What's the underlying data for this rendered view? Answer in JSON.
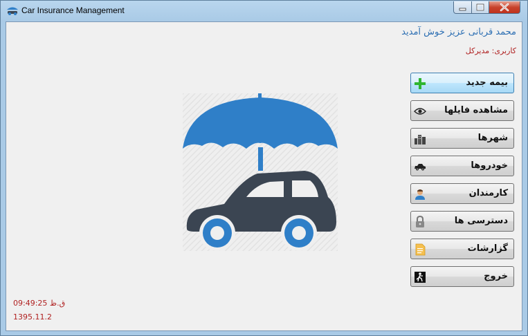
{
  "window": {
    "title": "Car Insurance Management"
  },
  "header": {
    "welcome": "محمد قربانی عزیز خوش آمدید",
    "user_line": "کاربری: مدیرکل"
  },
  "menu": [
    {
      "label": "بیمه جدید",
      "icon": "plus-icon",
      "active": true
    },
    {
      "label": "مشاهده فایلها",
      "icon": "eye-icon",
      "active": false
    },
    {
      "label": "شهرها",
      "icon": "city-icon",
      "active": false
    },
    {
      "label": "خودروها",
      "icon": "car-icon",
      "active": false
    },
    {
      "label": "کارمندان",
      "icon": "employee-icon",
      "active": false
    },
    {
      "label": "دسترسی ها",
      "icon": "lock-icon",
      "active": false
    },
    {
      "label": "گزارشات",
      "icon": "report-icon",
      "active": false
    },
    {
      "label": "خروج",
      "icon": "exit-icon",
      "active": false
    }
  ],
  "status": {
    "time": "ق.ظ 09:49:25",
    "date": "1395.11.2"
  },
  "colors": {
    "accent_blue": "#2f7fc8",
    "car_dark": "#3b4552",
    "status_red": "#b02020",
    "welcome_blue": "#2d6fb3"
  }
}
